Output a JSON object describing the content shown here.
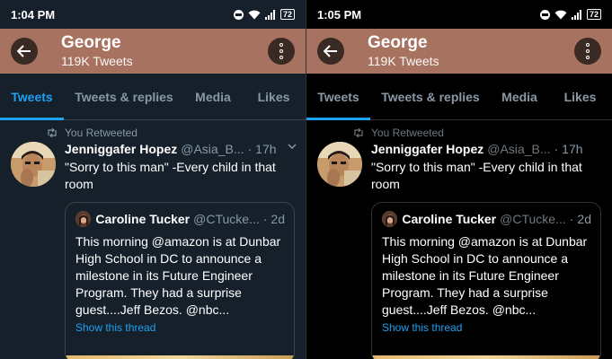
{
  "screens": [
    {
      "status": {
        "time": "1:04 PM",
        "battery": "72"
      },
      "header": {
        "name": "George",
        "tweet_count": "119K Tweets"
      },
      "tabs": [
        "Tweets",
        "Tweets & replies",
        "Media",
        "Likes"
      ],
      "retweet_label": "You Retweeted",
      "tweet": {
        "author": "Jenniggafer Hopez",
        "handle": "@Asia_B...",
        "time": "17h",
        "text": "\"Sorry to this man\" -Every child in that room"
      },
      "quote": {
        "author": "Caroline Tucker",
        "handle": "@CTucke...",
        "time": "2d",
        "text": "This morning @amazon is at Dunbar High School in DC to announce a milestone in its Future Engineer Program. They had a surprise guest....Jeff Bezos. @nbc...",
        "show_thread": "Show this thread"
      }
    },
    {
      "status": {
        "time": "1:05 PM",
        "battery": "72"
      },
      "header": {
        "name": "George",
        "tweet_count": "119K Tweets"
      },
      "tabs": [
        "Tweets",
        "Tweets & replies",
        "Media",
        "Likes"
      ],
      "retweet_label": "You Retweeted",
      "tweet": {
        "author": "Jenniggafer Hopez",
        "handle": "@Asia_B...",
        "time": "17h",
        "text": "\"Sorry to this man\" -Every child in that room"
      },
      "quote": {
        "author": "Caroline Tucker",
        "handle": "@CTucke...",
        "time": "2d",
        "text": "This morning @amazon is at Dunbar High School in DC to announce a milestone in its Future Engineer Program. They had a surprise guest....Jeff Bezos. @nbc...",
        "show_thread": "Show this thread"
      }
    }
  ],
  "colors": {
    "header_bg": "#a87260",
    "accent": "#1da1f2",
    "dim_bg": "#15202b",
    "black_bg": "#000000"
  },
  "icons": [
    "back-arrow-icon",
    "more-vertical-icon",
    "retweet-icon",
    "chevron-down-icon",
    "wifi-icon",
    "signal-icon",
    "dnd-icon",
    "battery-icon"
  ]
}
